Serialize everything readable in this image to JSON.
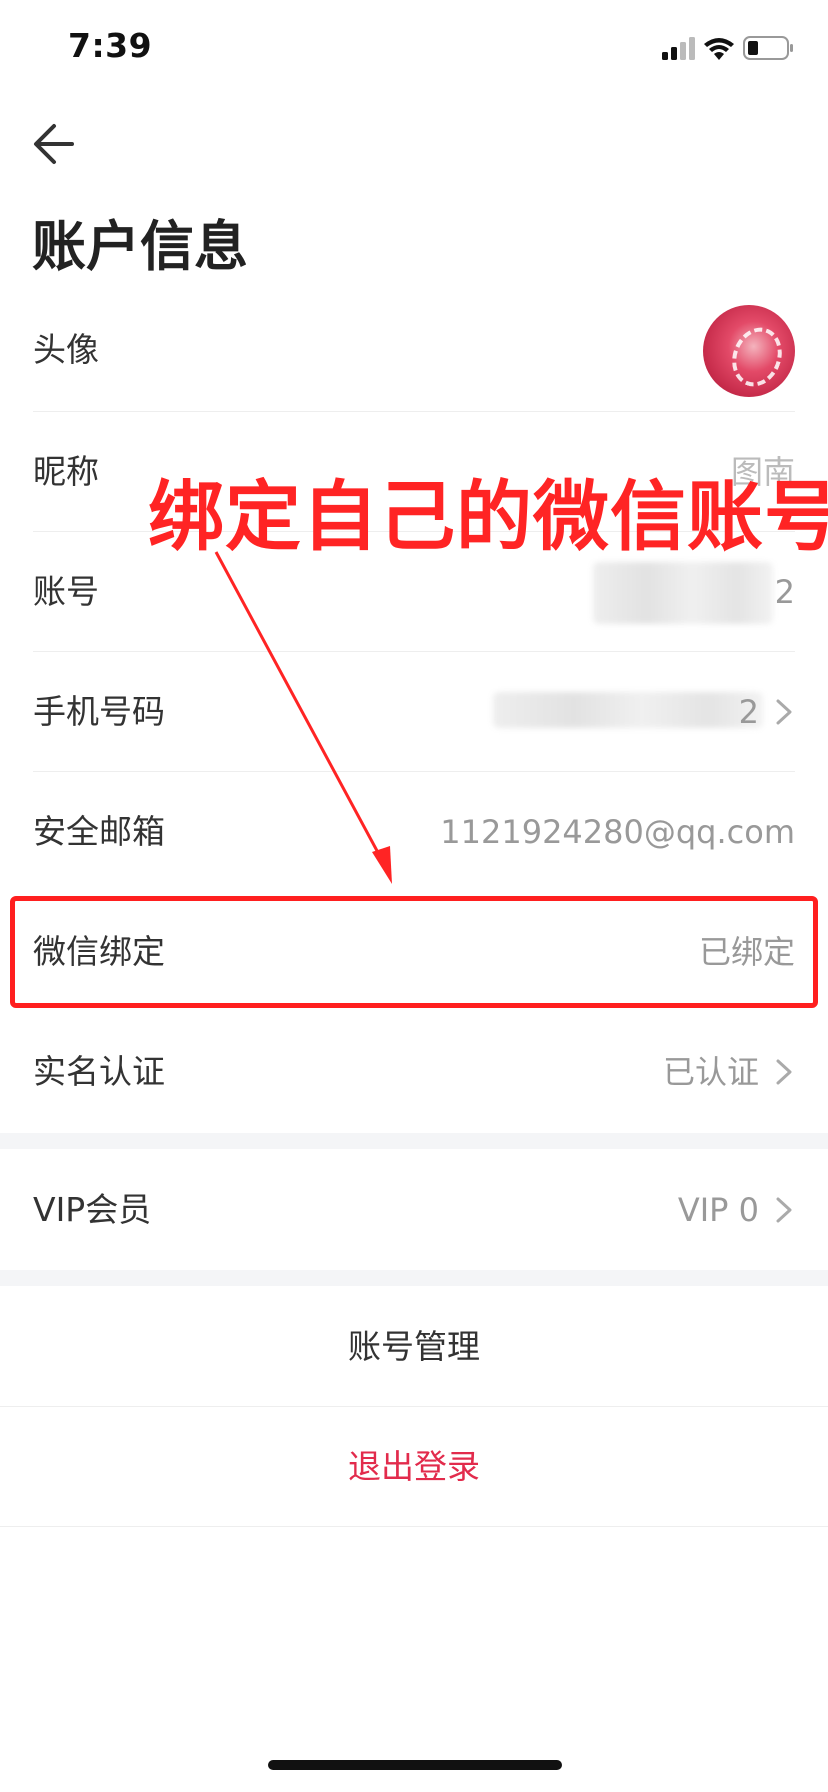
{
  "status_bar": {
    "time": "7:39"
  },
  "page": {
    "title": "账户信息"
  },
  "rows": {
    "avatar": {
      "label": "头像"
    },
    "nickname": {
      "label": "昵称",
      "value": "图南"
    },
    "account": {
      "label": "账号",
      "value_visible": "2"
    },
    "phone": {
      "label": "手机号码",
      "value_visible": "2"
    },
    "email": {
      "label": "安全邮箱",
      "value": "1121924280@qq.com"
    },
    "wechat": {
      "label": "微信绑定",
      "value": "已绑定"
    },
    "realname": {
      "label": "实名认证",
      "value": "已认证"
    },
    "vip": {
      "label": "VIP会员",
      "value": "VIP 0"
    }
  },
  "actions": {
    "manage": "账号管理",
    "logout": "退出登录"
  },
  "annotation": {
    "text": "绑定自己的微信账号"
  },
  "colors": {
    "accent_red": "#e22b4c",
    "annotation_red": "#ff1f1f",
    "band_gray": "#f4f5f7"
  },
  "icons": [
    "back-arrow-icon",
    "signal-icon",
    "wifi-icon",
    "battery-icon",
    "chevron-right-icon"
  ]
}
